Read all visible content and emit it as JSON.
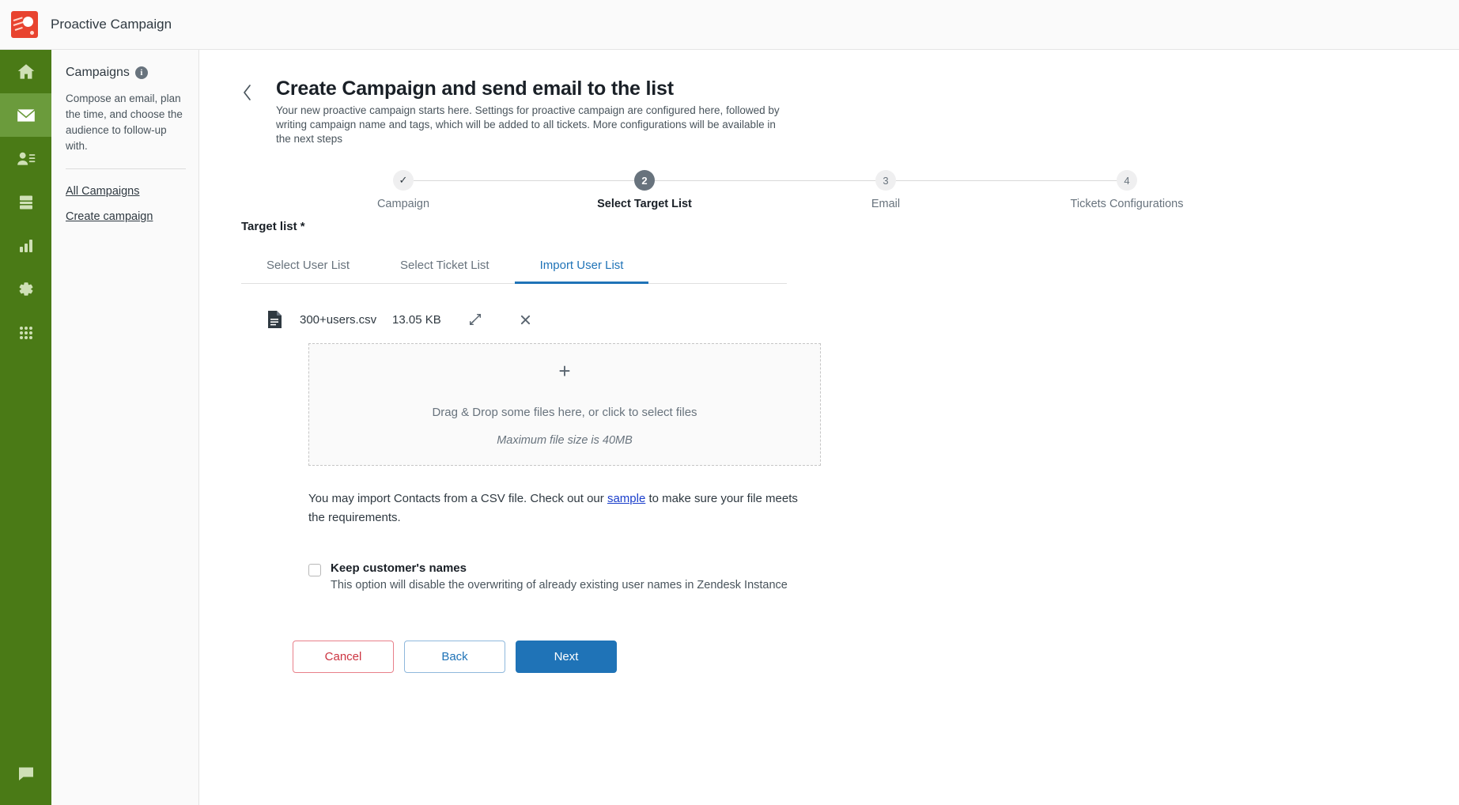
{
  "topbar": {
    "brand_title": "Proactive Campaign",
    "logo_color": "#e8432f"
  },
  "rail": {
    "items": [
      {
        "name": "home-icon",
        "label": "Home",
        "active": false
      },
      {
        "name": "mail-icon",
        "label": "Campaigns",
        "active": true
      },
      {
        "name": "user-list-icon",
        "label": "Users",
        "active": false
      },
      {
        "name": "database-icon",
        "label": "Data",
        "active": false
      },
      {
        "name": "bar-chart-icon",
        "label": "Reports",
        "active": false
      },
      {
        "name": "gear-icon",
        "label": "Settings",
        "active": false
      },
      {
        "name": "apps-grid-icon",
        "label": "Apps",
        "active": false
      }
    ],
    "bottom_item": {
      "name": "chat-icon",
      "label": "Support"
    },
    "background": "#4a7a16",
    "active_background": "#6b9b3c"
  },
  "panel": {
    "title": "Campaigns",
    "info_icon": "i",
    "description": "Compose an email, plan the time, and choose the audience to follow-up with.",
    "links": [
      {
        "label": "All Campaigns"
      },
      {
        "label": "Create campaign"
      }
    ]
  },
  "page": {
    "back_chevron": "‹",
    "title": "Create Campaign and send email to the list",
    "subtitle": "Your new proactive campaign starts here. Settings for proactive campaign are configured here, followed by writing campaign name and tags, which will be added to all tickets. More configurations will be available in the next steps"
  },
  "stepper": {
    "steps": [
      {
        "num": "✓",
        "label": "Campaign",
        "state": "done"
      },
      {
        "num": "2",
        "label": "Select Target List",
        "state": "current"
      },
      {
        "num": "3",
        "label": "Email",
        "state": "todo"
      },
      {
        "num": "4",
        "label": "Tickets Configurations",
        "state": "todo"
      }
    ],
    "accent_current": "#68737d",
    "accent_inactive": "#efeff0"
  },
  "form": {
    "target_list_label": "Target list *",
    "tabs": [
      {
        "label": "Select User List",
        "active": false
      },
      {
        "label": "Select Ticket List",
        "active": false
      },
      {
        "label": "Import User List",
        "active": true
      }
    ],
    "tab_accent": "#1f73b7",
    "uploaded_file": {
      "icon": "document-icon",
      "name": "300+users.csv",
      "size": "13.05 KB",
      "replace_icon": "swap-arrows-icon",
      "remove_icon": "close-icon"
    },
    "dropzone": {
      "plus": "+",
      "primary_text": "Drag & Drop some files here, or click to select files",
      "secondary_text": "Maximum file size is 40MB"
    },
    "helper": {
      "before": "You may import Contacts from a CSV file. Check out our ",
      "link": "sample",
      "after": " to make sure your file meets the requirements.",
      "link_color": "#1a3ecb"
    },
    "checkbox": {
      "checked": false,
      "title": "Keep customer's names",
      "description": "This option will disable the overwriting of already existing user names in Zendesk Instance"
    }
  },
  "buttons": {
    "cancel": "Cancel",
    "back": "Back",
    "next": "Next",
    "cancel_color": "#cc3340",
    "back_color": "#1f73b7",
    "next_bg": "#1f73b7"
  }
}
